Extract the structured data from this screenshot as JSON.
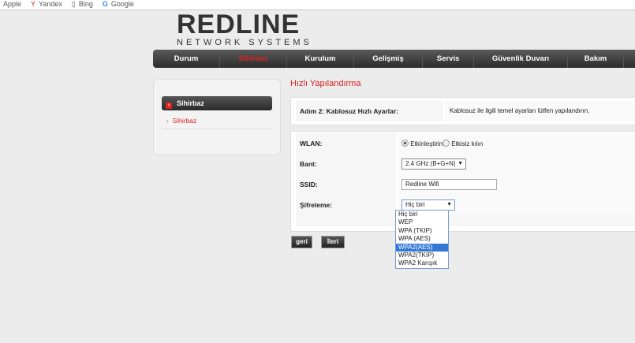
{
  "bookmarks": [
    "Apple",
    "Yandex",
    "Bing",
    "Google"
  ],
  "logo": {
    "name": "REDLINE",
    "tagline": "NETWORK SYSTEMS"
  },
  "nav": [
    {
      "label": "Durum"
    },
    {
      "label": "Sihirbaz",
      "active": true
    },
    {
      "label": "Kurulum"
    },
    {
      "label": "Gelişmiş"
    },
    {
      "label": "Servis"
    },
    {
      "label": "Güvenlik Duvarı"
    },
    {
      "label": "Bakım"
    }
  ],
  "sidebar": {
    "header": "Sihirbaz",
    "link": "Sihirbaz"
  },
  "page_title": "Hızlı Yapılandırma",
  "step": {
    "label": "Adım 2: Kablosuz Hızlı Ayarlar:",
    "description": "Kablosuz ile ilgili temel ayarları lütfen yapılandırın."
  },
  "form": {
    "wlan": {
      "label": "WLAN:",
      "enable": "Etkinleştirin",
      "disable": "Etkisiz kılın",
      "selected": "enable"
    },
    "band": {
      "label": "Bant:",
      "value": "2.4 GHz (B+G+N)"
    },
    "ssid": {
      "label": "SSID:",
      "value": "Redline Wifi"
    },
    "encryption": {
      "label": "Şifreleme:",
      "value": "Hiç biri",
      "options": [
        "Hiç biri",
        "WEP",
        "WPA (TKIP)",
        "WPA (AES)",
        "WPA2(AES)",
        "WPA2(TKIP)",
        "WPA2 Karışık"
      ],
      "highlighted": "WPA2(AES)"
    }
  },
  "buttons": {
    "back": "geri",
    "next": "İleri"
  },
  "colors": {
    "accent": "#dd2222",
    "highlight": "#3478d6"
  }
}
